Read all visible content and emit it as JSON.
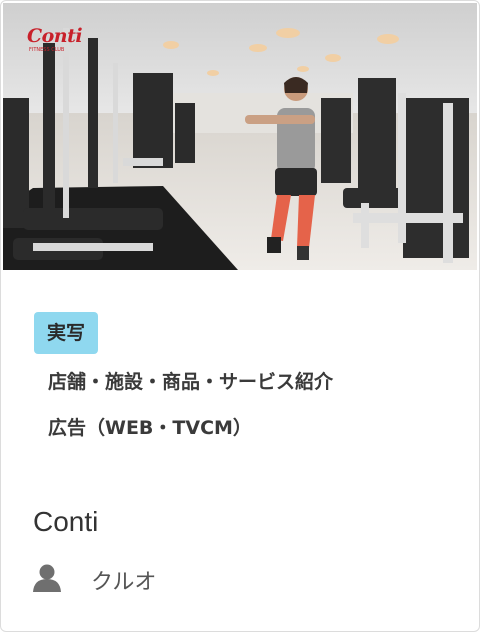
{
  "card": {
    "logo": {
      "brand": "Conti",
      "tagline": "FITNESS CLUB"
    },
    "badge": "実写",
    "categories": [
      "店舗・施設・商品・サービス紹介",
      "広告（WEB・TVCM）"
    ],
    "title": "Conti",
    "author": "クルオ",
    "icons": {
      "author": "person-icon"
    }
  }
}
